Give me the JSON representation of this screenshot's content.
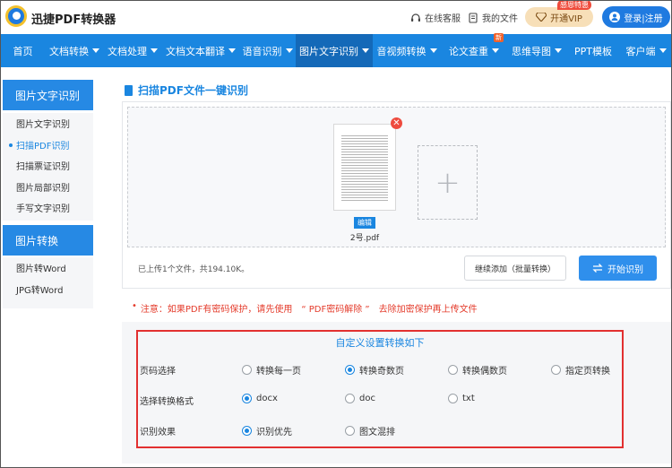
{
  "header": {
    "brand": "迅捷PDF转换器",
    "service_label": "在线客服",
    "files_label": "我的文件",
    "vip_label": "开通VIP",
    "vip_badge": "感恩特惠",
    "login_label": "登录|注册"
  },
  "nav": {
    "items": [
      {
        "label": "首页",
        "dropdown": false
      },
      {
        "label": "文档转换",
        "dropdown": true
      },
      {
        "label": "文档处理",
        "dropdown": true
      },
      {
        "label": "文档文本翻译",
        "dropdown": true
      },
      {
        "label": "语音识别",
        "dropdown": true
      },
      {
        "label": "图片文字识别",
        "dropdown": true,
        "active": true
      },
      {
        "label": "音视频转换",
        "dropdown": true
      },
      {
        "label": "论文查重",
        "dropdown": true,
        "badge": "新"
      },
      {
        "label": "思维导图",
        "dropdown": true
      },
      {
        "label": "PPT模板",
        "dropdown": false
      },
      {
        "label": "客户端",
        "dropdown": true
      }
    ]
  },
  "sidebar": {
    "group1_title": "图片文字识别",
    "group1_items": [
      "图片文字识别",
      "扫描PDF识别",
      "扫描票证识别",
      "图片局部识别",
      "手写文字识别"
    ],
    "group2_title": "图片转换",
    "group2_items": [
      "图片转Word",
      "JPG转Word"
    ]
  },
  "main": {
    "title": "扫描PDF文件一键识别",
    "file": {
      "name": "2号.pdf",
      "edit_label": "编辑",
      "close_glyph": "✕"
    },
    "add_glyph": "+",
    "upload_status": "已上传1个文件，共194.10K。",
    "continue_button": "继续添加（批量转换）",
    "start_button": "开始识别",
    "note_dot": "•",
    "note_prefix": "注意：如果PDF有密码保护，请先使用",
    "note_link": "“ PDF密码解除 ”",
    "note_suffix": "去除加密保护再上传文件"
  },
  "settings": {
    "title": "自定义设置转换如下",
    "page_label": "页码选择",
    "page_options": [
      {
        "label": "转换每一页",
        "checked": false
      },
      {
        "label": "转换奇数页",
        "checked": true
      },
      {
        "label": "转换偶数页",
        "checked": false
      },
      {
        "label": "指定页转换",
        "checked": false
      }
    ],
    "format_label": "选择转换格式",
    "format_options": [
      {
        "label": "docx",
        "checked": true
      },
      {
        "label": "doc",
        "checked": false
      },
      {
        "label": "txt",
        "checked": false
      }
    ],
    "effect_label": "识别效果",
    "effect_options": [
      {
        "label": "识别优先",
        "checked": true
      },
      {
        "label": "图文混排",
        "checked": false
      }
    ]
  },
  "colors": {
    "accent": "#1a86e0",
    "nav_active": "#1469b8",
    "warning": "#e43b2b",
    "vip_bg": "#f7dfb8"
  }
}
